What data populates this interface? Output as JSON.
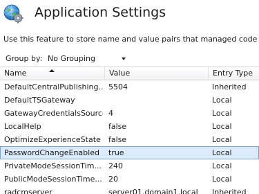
{
  "header": {
    "title": "Application Settings",
    "icon": "globe-gear-icon"
  },
  "description": "Use this feature to store name and value pairs that managed code appl",
  "group_by": {
    "label": "Group by:",
    "value": "No Grouping"
  },
  "table": {
    "columns": [
      "Name",
      "Value",
      "Entry Type"
    ],
    "sort_column": "Name",
    "sort_direction": "ascending",
    "rows": [
      {
        "name": "DefaultCentralPublishing...",
        "value": "5504",
        "type": "Inherited"
      },
      {
        "name": "DefaultTSGateway",
        "value": "",
        "type": "Local"
      },
      {
        "name": "GatewayCredentialsSource",
        "value": "4",
        "type": "Local"
      },
      {
        "name": "LocalHelp",
        "value": "false",
        "type": "Local"
      },
      {
        "name": "OptimizeExperienceState",
        "value": "false",
        "type": "Local"
      },
      {
        "name": "PasswordChangeEnabled",
        "value": "true",
        "type": "Local"
      },
      {
        "name": "PrivateModeSessionTim...",
        "value": "240",
        "type": "Local"
      },
      {
        "name": "PublicModeSessionTime...",
        "value": "20",
        "type": "Local"
      },
      {
        "name": "radcmserver",
        "value": "server01.domain1.local",
        "type": "Inherited"
      }
    ],
    "selected_row": "PasswordChangeEnabled"
  },
  "colors": {
    "selection_fill": "#dcebfc",
    "selection_border": "#7da2ce",
    "title_text": "#1e1e1e"
  }
}
